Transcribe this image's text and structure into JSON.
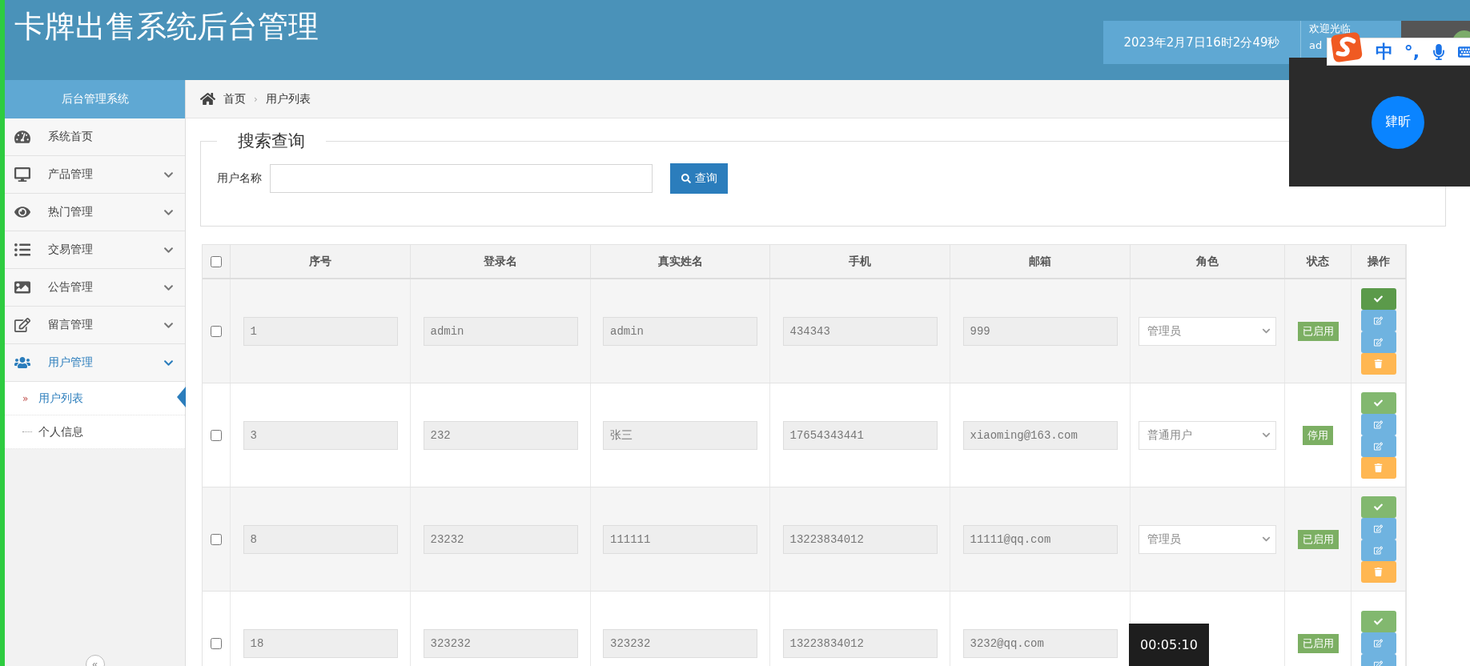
{
  "header": {
    "title": "卡牌出售系统后台管理",
    "datetime": "2023年2月7日16时2分49秒",
    "welcome": "欢迎光临",
    "username": "ad"
  },
  "ime_bar": {
    "mode": "中",
    "punctuation": "°,"
  },
  "floating_panel": {
    "button": "肄昕"
  },
  "video_timer": "00:05:10",
  "sidebar": {
    "title": "后台管理系统",
    "items": [
      {
        "label": "系统首页"
      },
      {
        "label": "产品管理",
        "expanded": false
      },
      {
        "label": "热门管理",
        "expanded": false
      },
      {
        "label": "交易管理",
        "expanded": false
      },
      {
        "label": "公告管理",
        "expanded": false
      },
      {
        "label": "留言管理",
        "expanded": false
      },
      {
        "label": "用户管理",
        "expanded": true,
        "children": [
          {
            "label": "用户列表",
            "selected": true
          },
          {
            "label": "个人信息",
            "selected": false
          }
        ]
      }
    ],
    "active_marker": "»",
    "collapse": "«"
  },
  "breadcrumb": [
    "首页",
    "用户列表"
  ],
  "breadcrumb_separator": "›",
  "search": {
    "legend": "搜索查询",
    "label": "用户名称",
    "button": "查询"
  },
  "table": {
    "all_checked": false,
    "columns": [
      "序号",
      "登录名",
      "真实姓名",
      "手机",
      "邮箱",
      "角色",
      "状态",
      "操作"
    ],
    "rows": [
      {
        "checked": false,
        "cells": [
          "1",
          "admin",
          "admin",
          "434343",
          "999"
        ],
        "role": "管理员",
        "status": "已启用",
        "hovered": true,
        "actions": [
          {
            "kind": "approve"
          },
          {
            "kind": "edit"
          },
          {
            "kind": "edit"
          },
          {
            "kind": "delete"
          }
        ]
      },
      {
        "checked": false,
        "cells": [
          "3",
          "232",
          "张三",
          "17654343441",
          "xiaoming@163.com"
        ],
        "role": "普通用户",
        "status": "停用",
        "hovered": false,
        "actions": [
          {
            "kind": "approve"
          },
          {
            "kind": "edit"
          },
          {
            "kind": "edit"
          },
          {
            "kind": "delete"
          }
        ]
      },
      {
        "checked": false,
        "cells": [
          "8",
          "23232",
          "111111",
          "13223834012",
          "11111@qq.com"
        ],
        "role": "管理员",
        "status": "已启用",
        "hovered": false,
        "actions": [
          {
            "kind": "approve"
          },
          {
            "kind": "edit"
          },
          {
            "kind": "edit"
          },
          {
            "kind": "delete"
          }
        ]
      },
      {
        "checked": false,
        "cells": [
          "18",
          "323232",
          "323232",
          "13223834012",
          "3232@qq.com"
        ],
        "status": "已启用",
        "hovered": false,
        "actions": [
          {
            "kind": "approve"
          },
          {
            "kind": "edit"
          },
          {
            "kind": "edit"
          }
        ]
      }
    ]
  }
}
